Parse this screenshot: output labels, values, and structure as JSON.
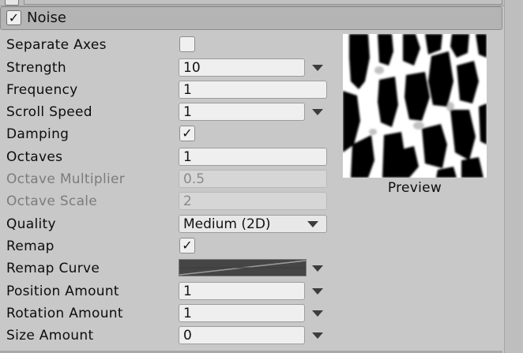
{
  "module": {
    "title": "Noise",
    "enabled": true
  },
  "rows": [
    {
      "label": "Separate Axes",
      "type": "checkbox",
      "checked": false
    },
    {
      "label": "Strength",
      "type": "curve-field",
      "value": "10"
    },
    {
      "label": "Frequency",
      "type": "field",
      "value": "1"
    },
    {
      "label": "Scroll Speed",
      "type": "curve-field",
      "value": "1"
    },
    {
      "label": "Damping",
      "type": "checkbox",
      "checked": true
    },
    {
      "label": "Octaves",
      "type": "field",
      "value": "1"
    },
    {
      "label": "Octave Multiplier",
      "type": "field-disabled",
      "value": "0.5"
    },
    {
      "label": "Octave Scale",
      "type": "field-disabled",
      "value": "2"
    },
    {
      "label": "Quality",
      "type": "select",
      "value": "Medium (2D)"
    },
    {
      "label": "Remap",
      "type": "checkbox",
      "checked": true
    },
    {
      "label": "Remap Curve",
      "type": "curve"
    },
    {
      "label": "Position Amount",
      "type": "curve-field",
      "value": "1"
    },
    {
      "label": "Rotation Amount",
      "type": "curve-field",
      "value": "1"
    },
    {
      "label": "Size Amount",
      "type": "curve-field",
      "value": "0"
    }
  ],
  "preview": {
    "label": "Preview"
  },
  "check_glyph": "✓"
}
